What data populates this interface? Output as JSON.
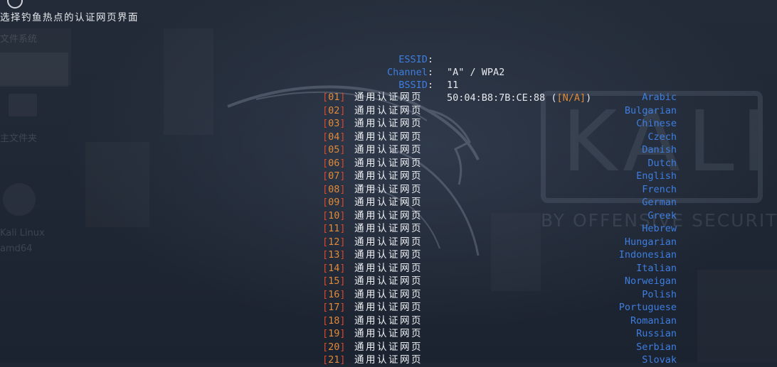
{
  "header": {
    "title": "选择钓鱼热点的认证网页界面"
  },
  "network_info": {
    "essid_key": "ESSID",
    "essid_value": "\"A\" / WPA2",
    "channel_key": "Channel",
    "channel_value": "11",
    "bssid_key": "BSSID",
    "bssid_value": "50:04:B8:7B:CE:88",
    "bssid_vendor": "N/A"
  },
  "desktop": {
    "labels": [
      "文件系统",
      "主文件夹",
      "Kali Linux",
      "amd64"
    ]
  },
  "background": {
    "logo_text": "KALI",
    "logo_subtext": "BY OFFENSIVE SECURITY"
  },
  "menu": {
    "items": [
      {
        "number": "01",
        "label": "通用认证网页",
        "language": "Arabic"
      },
      {
        "number": "02",
        "label": "通用认证网页",
        "language": "Bulgarian"
      },
      {
        "number": "03",
        "label": "通用认证网页",
        "language": "Chinese"
      },
      {
        "number": "04",
        "label": "通用认证网页",
        "language": "Czech"
      },
      {
        "number": "05",
        "label": "通用认证网页",
        "language": "Danish"
      },
      {
        "number": "06",
        "label": "通用认证网页",
        "language": "Dutch"
      },
      {
        "number": "07",
        "label": "通用认证网页",
        "language": "English"
      },
      {
        "number": "08",
        "label": "通用认证网页",
        "language": "French"
      },
      {
        "number": "09",
        "label": "通用认证网页",
        "language": "German"
      },
      {
        "number": "10",
        "label": "通用认证网页",
        "language": "Greek"
      },
      {
        "number": "11",
        "label": "通用认证网页",
        "language": "Hebrew"
      },
      {
        "number": "12",
        "label": "通用认证网页",
        "language": "Hungarian"
      },
      {
        "number": "13",
        "label": "通用认证网页",
        "language": "Indonesian"
      },
      {
        "number": "14",
        "label": "通用认证网页",
        "language": "Italian"
      },
      {
        "number": "15",
        "label": "通用认证网页",
        "language": "Norweigan"
      },
      {
        "number": "16",
        "label": "通用认证网页",
        "language": "Polish"
      },
      {
        "number": "17",
        "label": "通用认证网页",
        "language": "Portuguese"
      },
      {
        "number": "18",
        "label": "通用认证网页",
        "language": "Romanian"
      },
      {
        "number": "19",
        "label": "通用认证网页",
        "language": "Russian"
      },
      {
        "number": "20",
        "label": "通用认证网页",
        "language": "Serbian"
      },
      {
        "number": "21",
        "label": "通用认证网页",
        "language": "Slovak"
      }
    ]
  },
  "colors": {
    "background": "#1f2633",
    "key_blue": "#3d7ee0",
    "bracket_red": "#d9472b",
    "number_orange": "#e08a3a",
    "text_white": "#e6e8ec"
  }
}
